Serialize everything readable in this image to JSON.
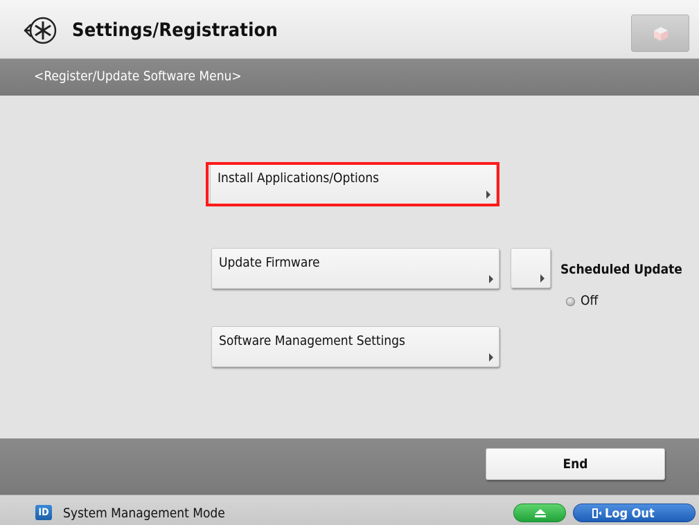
{
  "header": {
    "title": "Settings/Registration",
    "title_icon": "settings-registration-icon",
    "right_button_icon": "cube-icon"
  },
  "subheader": {
    "text": "<Register/Update Software Menu>"
  },
  "menu": {
    "install_label": "Install Applications/Options",
    "firmware_label": "Update Firmware",
    "software_mgmt_label": "Software Management Settings"
  },
  "scheduled_update": {
    "label": "Scheduled Update",
    "status": "Off"
  },
  "actions": {
    "end_label": "End"
  },
  "statusbar": {
    "id_badge": "ID",
    "mode_text": "System Management Mode",
    "logout_label": "Log Out"
  },
  "colors": {
    "highlight": "#ff1a1a",
    "eject_button": "#2fb84a",
    "logout_button": "#2a6fcb",
    "id_badge": "#2a74c4"
  }
}
